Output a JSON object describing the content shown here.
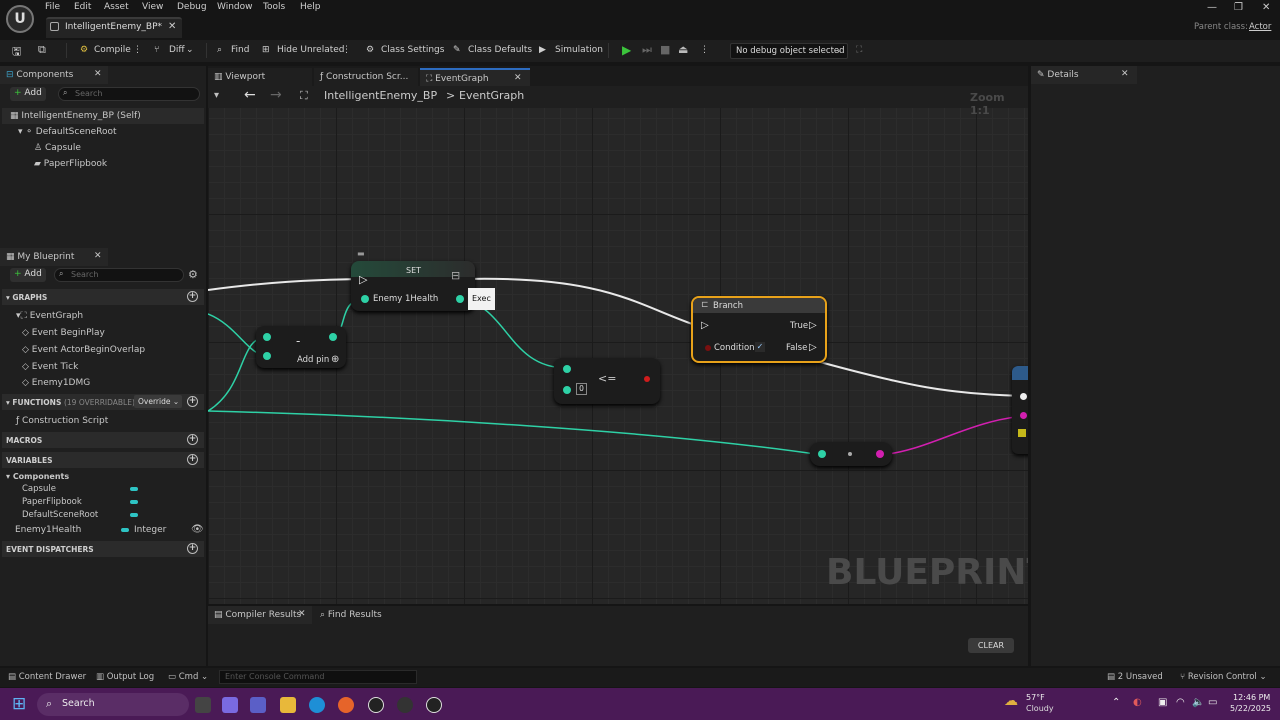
{
  "menu": [
    "File",
    "Edit",
    "Asset",
    "View",
    "Debug",
    "Window",
    "Tools",
    "Help"
  ],
  "document_tab": "IntelligentEnemy_BP*",
  "parent_class": {
    "label": "Parent class:",
    "value": "Actor"
  },
  "toolbar": {
    "compile": "Compile",
    "diff": "Diff",
    "find": "Find",
    "hide_unrelated": "Hide Unrelated",
    "class_settings": "Class Settings",
    "class_defaults": "Class Defaults",
    "simulation": "Simulation",
    "debug_object": "No debug object selected"
  },
  "components_panel": {
    "tab": "Components",
    "add": "Add",
    "search_placeholder": "Search",
    "tree": [
      "IntelligentEnemy_BP (Self)",
      "DefaultSceneRoot",
      "Capsule",
      "PaperFlipbook"
    ]
  },
  "my_blueprint": {
    "tab": "My Blueprint",
    "add": "Add",
    "search_placeholder": "Search",
    "graphs_header": "GRAPHS",
    "graphs": [
      "EventGraph",
      "Event BeginPlay",
      "Event ActorBeginOverlap",
      "Event Tick",
      "Enemy1DMG"
    ],
    "functions_header": "FUNCTIONS",
    "functions_count": "(19 OVERRIDABLE)",
    "override": "Override",
    "functions": [
      "Construction Script"
    ],
    "macros_header": "MACROS",
    "variables_header": "VARIABLES",
    "var_group": "Components",
    "var_components": [
      "Capsule",
      "PaperFlipbook",
      "DefaultSceneRoot"
    ],
    "var_name": "Enemy1Health",
    "var_type": "Integer",
    "dispatchers_header": "EVENT DISPATCHERS"
  },
  "editor_tabs": [
    "Viewport",
    "Construction Scr...",
    "EventGraph"
  ],
  "breadcrumb": {
    "blueprint": "IntelligentEnemy_BP",
    "separator": ">",
    "graph": "EventGraph",
    "zoom": "Zoom 1:1"
  },
  "nodes": {
    "set_title": "SET",
    "set_var": "Enemy 1Health",
    "tooltip": "Exec",
    "subtract_symbol": "-",
    "add_pin": "Add pin",
    "compare_symbol": "<=",
    "compare_value": "0",
    "branch_title": "Branch",
    "branch_true": "True",
    "branch_false": "False",
    "branch_condition": "Condition"
  },
  "watermark": "BLUEPRINT",
  "details": {
    "tab": "Details"
  },
  "bottom_tabs": {
    "compiler_results": "Compiler Results",
    "find_results": "Find Results",
    "clear": "CLEAR"
  },
  "status_bar": {
    "content_drawer": "Content Drawer",
    "output_log": "Output Log",
    "cmd": "Cmd",
    "console_placeholder": "Enter Console Command",
    "unsaved": "2 Unsaved",
    "revision": "Revision Control"
  },
  "taskbar": {
    "search": "Search",
    "temp": "57°F",
    "weather": "Cloudy",
    "time": "12:46 PM",
    "date": "5/22/2025"
  },
  "colors": {
    "exec_wire": "#e8e8e8",
    "int_wire": "#2ed1a6",
    "pink_wire": "#d21fb0",
    "branch_border": "#e8a21a",
    "taskbar": "#4a1a56"
  }
}
